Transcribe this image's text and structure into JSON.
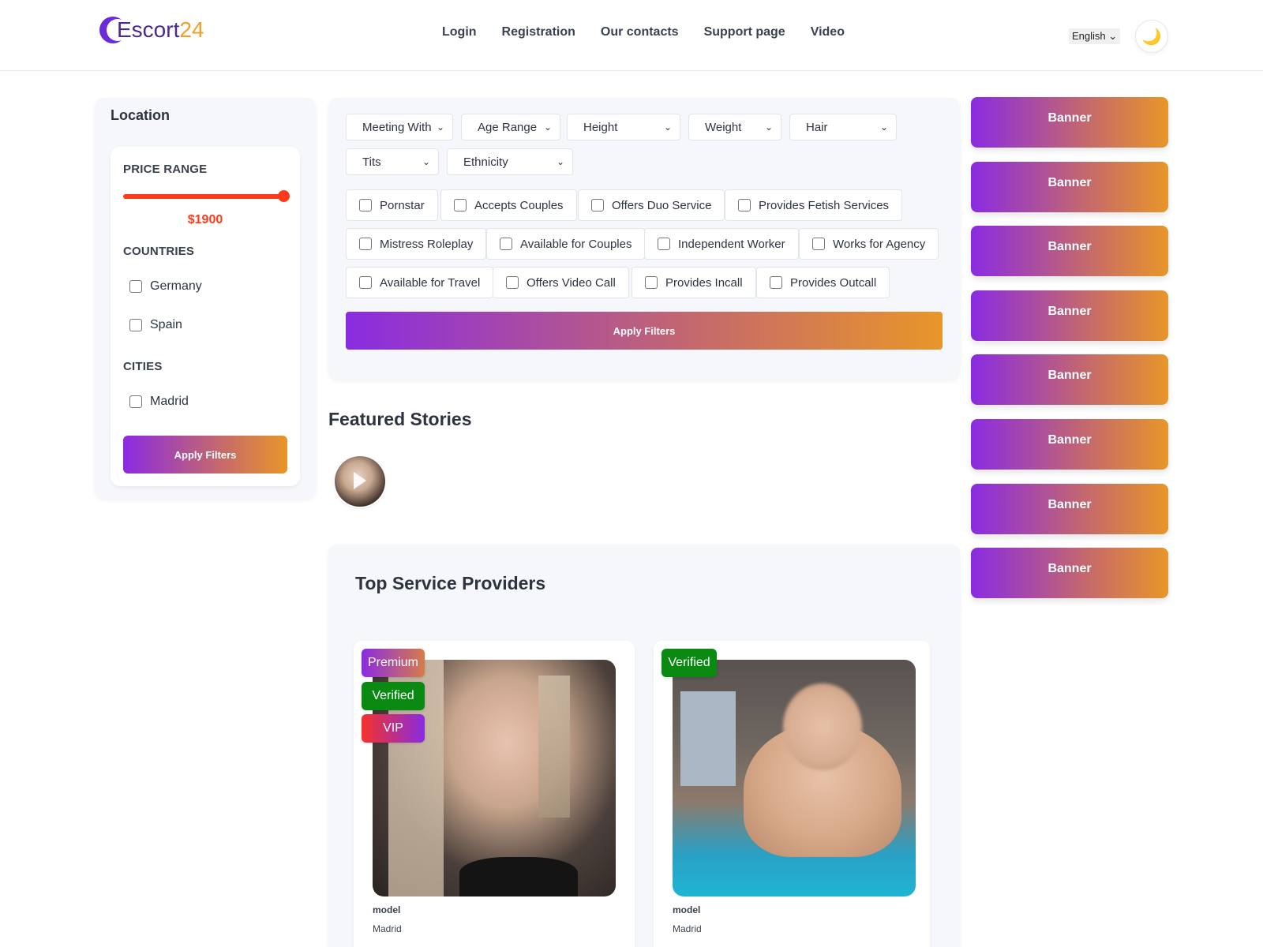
{
  "header": {
    "logo": {
      "part1": "Escort",
      "part2": "24"
    },
    "nav": [
      "Login",
      "Registration",
      "Our contacts",
      "Support page",
      "Video"
    ],
    "language": "English",
    "theme_icon": "moon-icon",
    "theme_glyph": "🌙"
  },
  "sidebar": {
    "title": "Location",
    "price_range_label": "PRICE RANGE",
    "price_value": "$1900",
    "price_slider_fraction": 1.0,
    "countries_label": "COUNTRIES",
    "countries": [
      "Germany",
      "Spain"
    ],
    "cities_label": "CITIES",
    "cities": [
      "Madrid"
    ],
    "apply_label": "Apply Filters"
  },
  "filters": {
    "selects": [
      "Meeting With",
      "Age Range",
      "Height",
      "Weight",
      "Hair",
      "Tits",
      "Ethnicity"
    ],
    "checkboxes": [
      "Pornstar",
      "Accepts Couples",
      "Offers Duo Service",
      "Provides Fetish Services",
      "Mistress Roleplay",
      "Available for Couples",
      "Independent Worker",
      "Works for Agency",
      "Available for Travel",
      "Offers Video Call",
      "Provides Incall",
      "Provides Outcall"
    ],
    "apply_label": "Apply Filters"
  },
  "featured": {
    "title": "Featured Stories"
  },
  "providers": {
    "title": "Top Service Providers",
    "cards": [
      {
        "name": "model",
        "city": "Madrid",
        "badges": [
          "Premium",
          "Verified",
          "VIP"
        ]
      },
      {
        "name": "model",
        "city": "Madrid",
        "badges": [
          "Verified"
        ]
      }
    ]
  },
  "banners": [
    "Banner",
    "Banner",
    "Banner",
    "Banner",
    "Banner",
    "Banner",
    "Banner",
    "Banner"
  ],
  "colors": {
    "accent_gradient_start": "#8a2be2",
    "accent_gradient_end": "#e8962a",
    "price_red": "#ff3a1a",
    "verified_green": "#0a8a12"
  }
}
